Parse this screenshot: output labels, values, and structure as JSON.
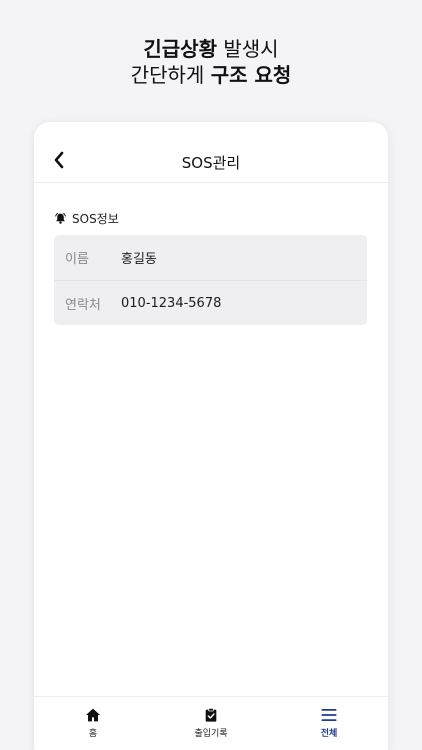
{
  "headline": {
    "line1_bold": "긴급상황",
    "line1_rest": " 발생시",
    "line2_rest": "간단하게 ",
    "line2_bold": "구조 요청"
  },
  "header": {
    "title": "SOS관리",
    "back_icon": "chevron-left-icon"
  },
  "section": {
    "icon": "bell-ringing-icon",
    "label": "SOS정보"
  },
  "info": [
    {
      "key": "이름",
      "value": "홍길동"
    },
    {
      "key": "연락처",
      "value": "010-1234-5678"
    }
  ],
  "nav": [
    {
      "label": "홈",
      "icon": "home-icon",
      "active": false
    },
    {
      "label": "출입기록",
      "icon": "clipboard-icon",
      "active": false
    },
    {
      "label": "전체",
      "icon": "menu-icon",
      "active": true
    }
  ],
  "colors": {
    "accent": "#1f3f8c",
    "card_bg": "#efeff1",
    "page_bg": "#f4f4f6"
  }
}
